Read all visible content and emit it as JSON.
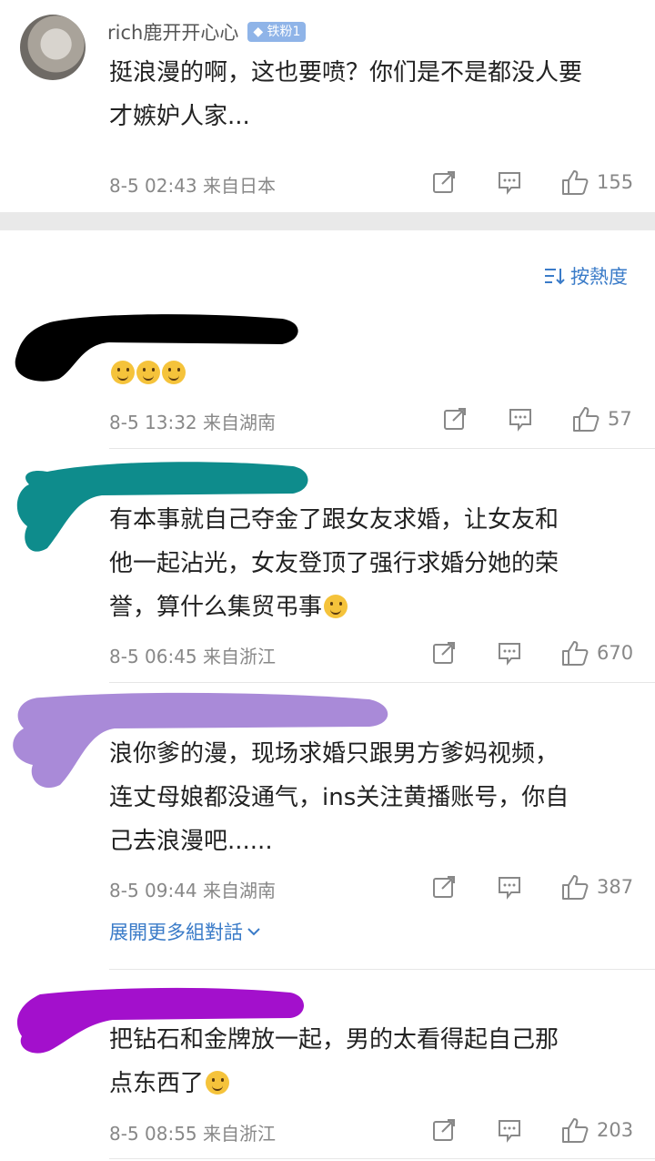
{
  "pinned": {
    "username": "rich鹿开开心心",
    "badge": "铁粉1",
    "text_lines": [
      "挺浪漫的啊，这也要喷？你们是不是都没人要",
      "才嫉妒人家..."
    ],
    "meta": "8-5 02:43 来自日本",
    "likes": "155"
  },
  "sort_label": "按熱度",
  "comments": [
    {
      "text_lines": [
        ""
      ],
      "meta": "8-5 13:32 来自湖南",
      "likes": "57"
    },
    {
      "text_lines": [
        "有本事就自己夺金了跟女友求婚，让女友和",
        "他一起沾光，女友登顶了强行求婚分她的荣",
        "誉，算什么集贸弔事"
      ],
      "meta": "8-5 06:45 来自浙江",
      "likes": "670"
    },
    {
      "text_lines": [
        "浪你爹的漫，现场求婚只跟男方爹妈视频，",
        "连丈母娘都没通气，ins关注黄播账号，你自",
        "己去浪漫吧......"
      ],
      "meta": "8-5 09:44 来自湖南",
      "likes": "387"
    },
    {
      "text_lines": [
        "把钻石和金牌放一起，男的太看得起自己那",
        "点东西了"
      ],
      "meta": "8-5 08:55 来自浙江",
      "likes": "203"
    }
  ],
  "expand_label": "展開更多組對話",
  "colors": {
    "link": "#3a7bc8",
    "meta": "#888888",
    "divider": "#e9e9e9",
    "badge": "#8fb4e8"
  }
}
